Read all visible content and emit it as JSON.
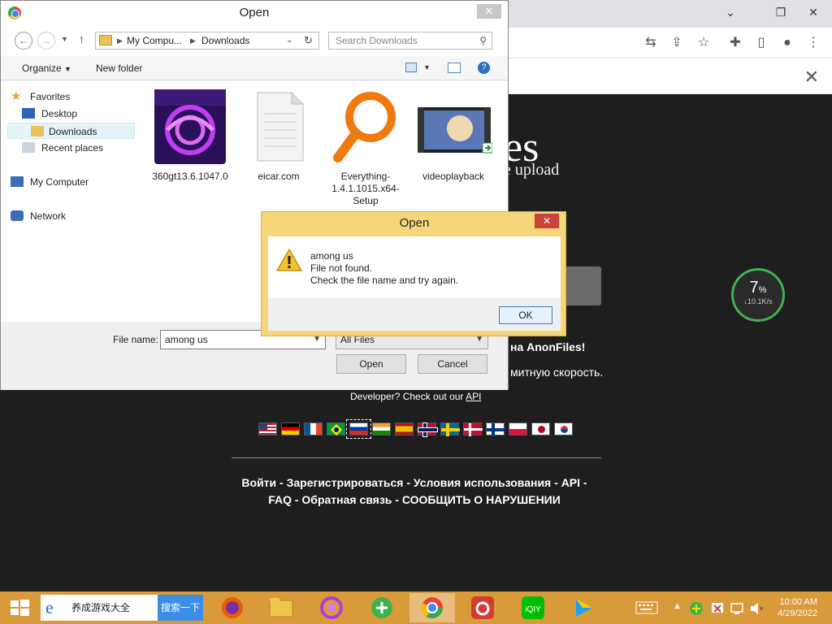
{
  "browser": {
    "infobar_close": "✕"
  },
  "page": {
    "logo_text": "es",
    "logo_sub": "e upload",
    "gauge": {
      "percent": "7",
      "percent_sign": "%",
      "speed": "↓10.1K/s"
    },
    "line_anon": "на AnonFiles!",
    "line_speed": "митную скорость.",
    "dev_text": "Developer? Check out our ",
    "dev_link": "API",
    "flags": [
      "us",
      "de",
      "fr",
      "br",
      "ru",
      "in",
      "es",
      "no",
      "se",
      "dk",
      "fi",
      "pl",
      "jp",
      "kr"
    ],
    "footer_line1": [
      "Войти",
      "Зарегистрироваться",
      "Условия использования",
      "API"
    ],
    "footer_line2": [
      "FAQ",
      "Обратная связь",
      "СООБЩИТЬ О НАРУШЕНИИ"
    ],
    "sep": " - "
  },
  "file_dialog": {
    "title": "Open",
    "close": "✕",
    "address": {
      "segments": [
        "My Compu...",
        "Downloads"
      ]
    },
    "search_placeholder": "Search Downloads",
    "organize": "Organize",
    "new_folder": "New folder",
    "nav": {
      "favorites": "Favorites",
      "desktop": "Desktop",
      "downloads": "Downloads",
      "recent": "Recent places",
      "computer": "My Computer",
      "network": "Network"
    },
    "files": [
      {
        "name": "360gt13.6.1047.0"
      },
      {
        "name": "eicar.com"
      },
      {
        "name": "Everything-1.4.1.1015.x64-Setup"
      },
      {
        "name": "videoplayback"
      }
    ],
    "filename_label": "File name:",
    "filename_value": "among us",
    "filter_value": "All Files",
    "open_btn": "Open",
    "cancel_btn": "Cancel"
  },
  "message_box": {
    "title": "Open",
    "close": "✕",
    "line1": "among us",
    "line2": "File not found.",
    "line3": "Check the file name and try again.",
    "ok": "OK"
  },
  "taskbar": {
    "search_text": "养成游戏大全",
    "search_button": "搜索一下",
    "time": "10:00 AM",
    "date": "4/29/2022"
  }
}
